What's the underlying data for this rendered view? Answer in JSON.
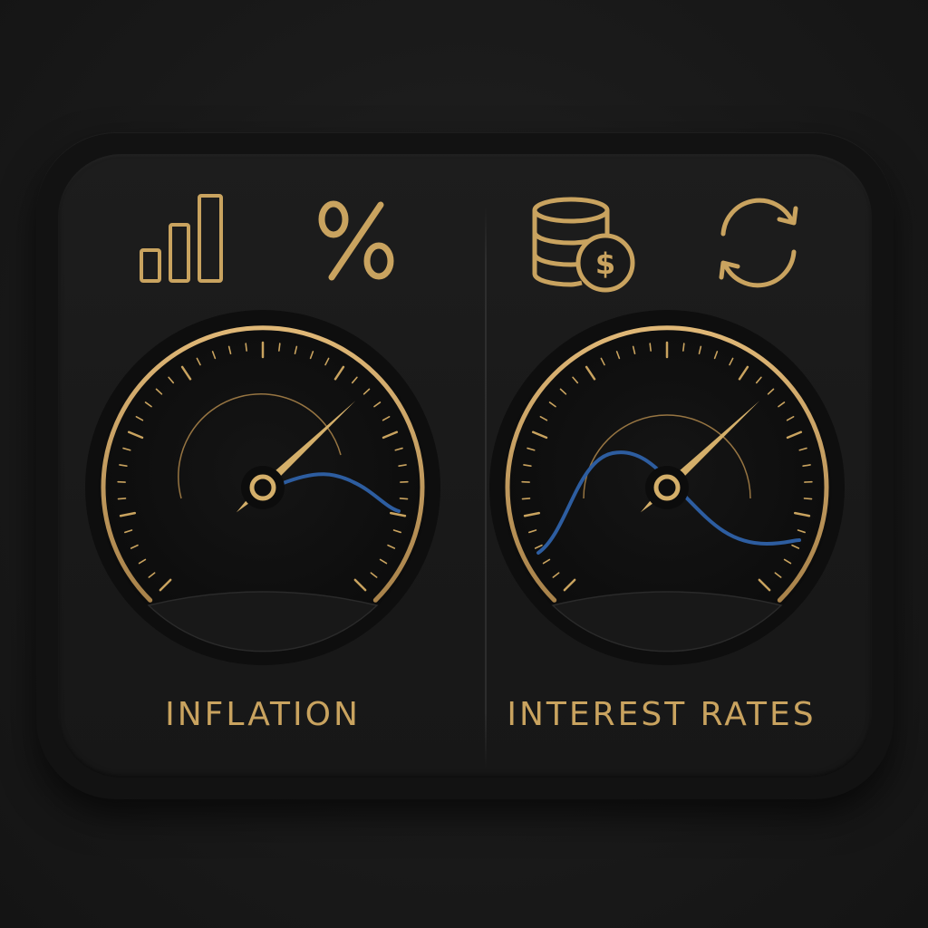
{
  "colors": {
    "background": "#1a1a1a",
    "panel": "#1b1b1b",
    "accent_gold": "#c9a35f",
    "curve_blue": "#2d5da0"
  },
  "panels": [
    {
      "title": "INFLATION",
      "icons": [
        "bar-chart-icon",
        "percent-icon"
      ],
      "needle_level": 0.78,
      "has_curve": true
    },
    {
      "title": "INTEREST RATES",
      "icons": [
        "coins-dollar-icon",
        "refresh-arrows-icon"
      ],
      "needle_level": 0.78,
      "has_curve": true
    }
  ]
}
